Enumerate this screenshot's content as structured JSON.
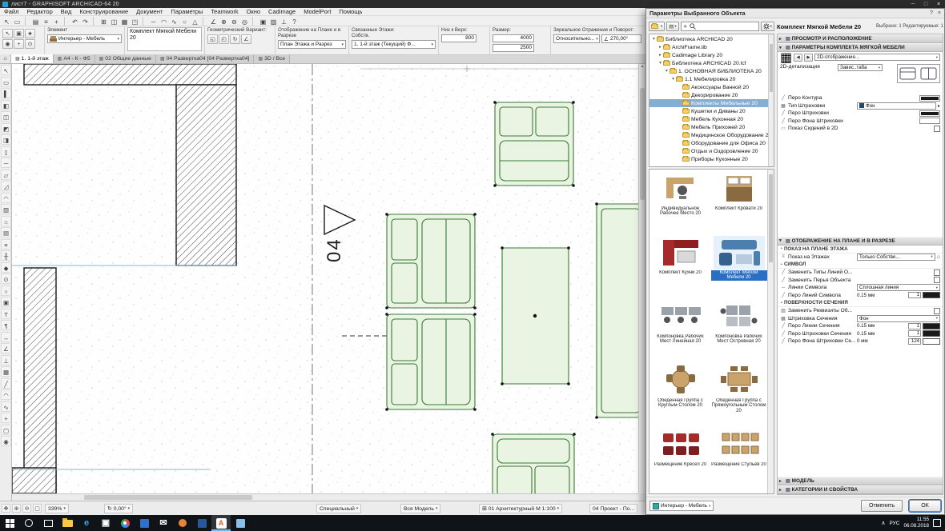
{
  "titlebar": {
    "title": "лист7 - GRAPHISOFT ARCHICAD-64 20",
    "controls": {
      "minimize": "─",
      "maximize": "□",
      "close": "×"
    }
  },
  "menubar": [
    "Файл",
    "Редактор",
    "Вид",
    "Конструирование",
    "Документ",
    "Параметры",
    "Teamwork",
    "Окно",
    "Cadimage",
    "ModelPort",
    "Помощь"
  ],
  "toolbar": [
    {
      "name": "select-tool-icon",
      "glyph": "↖"
    },
    {
      "name": "marquee-tool-icon",
      "glyph": "▭"
    },
    {
      "sep": true
    },
    {
      "name": "open-icon",
      "glyph": "▤"
    },
    {
      "name": "menu-icon",
      "glyph": "≡"
    },
    {
      "name": "add-icon",
      "glyph": "+"
    },
    {
      "sep": true
    },
    {
      "name": "undo-icon",
      "glyph": "↶"
    },
    {
      "name": "redo-icon",
      "glyph": "↷"
    },
    {
      "sep": true
    },
    {
      "name": "grid-icon",
      "glyph": "⊞"
    },
    {
      "name": "split-window-icon",
      "glyph": "◫"
    },
    {
      "name": "fill-display-icon",
      "glyph": "▦"
    },
    {
      "name": "view-icon",
      "glyph": "◳"
    },
    {
      "sep": true
    },
    {
      "name": "line-tool-icon",
      "glyph": "─"
    },
    {
      "name": "arc-tool-icon",
      "glyph": "◠"
    },
    {
      "name": "spline-tool-icon",
      "glyph": "∿"
    },
    {
      "name": "circle-tool-icon",
      "glyph": "○"
    },
    {
      "name": "polygon-tool-icon",
      "glyph": "△"
    },
    {
      "sep": true
    },
    {
      "name": "angle-icon",
      "glyph": "∠"
    },
    {
      "name": "zoom-in-icon",
      "glyph": "⊕"
    },
    {
      "name": "zoom-out-icon",
      "glyph": "⊖"
    },
    {
      "name": "find-icon",
      "glyph": "◎"
    },
    {
      "sep": true
    },
    {
      "name": "layout-icon",
      "glyph": "▣"
    },
    {
      "name": "hatch-icon",
      "glyph": "▨"
    },
    {
      "name": "level-icon",
      "glyph": "⊥"
    },
    {
      "name": "help-icon",
      "glyph": "?"
    }
  ],
  "infobox": {
    "quick_icons": [
      {
        "name": "arrow-settings-icon",
        "glyph": "↖"
      },
      {
        "name": "default-settings-icon",
        "glyph": "▣"
      },
      {
        "name": "favorites-icon",
        "glyph": "★"
      },
      {
        "name": "eyedropper-icon",
        "glyph": "◉"
      },
      {
        "name": "pointer-icon",
        "glyph": "+"
      },
      {
        "name": "pin-icon",
        "glyph": "⊙"
      }
    ],
    "element_label": "Элемент",
    "layer_value": "Интерьер - Мебель",
    "object_name": "Комплект Мягкой Мебели 20",
    "geometry_label": "Геометрический Вариант:",
    "geometry_icons": [
      {
        "name": "rotate-variant-1-icon",
        "glyph": "◱"
      },
      {
        "name": "rotate-variant-2-icon",
        "glyph": "◰"
      },
      {
        "name": "rotate-icon",
        "glyph": "↻"
      },
      {
        "name": "angle-variant-icon",
        "glyph": "∠"
      }
    ],
    "plan_label": "Отображение на Плане и в Разрезе",
    "plan_value": "План Этажа и Разрез",
    "stories_label": "Связанные Этажи:",
    "stories_own": "Собств.",
    "stories_value": "1. 1-й этаж (Текущий) Ф...",
    "bottom_label": "Низ к Верх:",
    "bottom_value": "800",
    "size_label": "Размер:",
    "size_w": "4000",
    "size_h": "2500",
    "mirror_label": "Зеркальное Отражение и Поворот:",
    "mirror_rel": "Относительно...",
    "angle_value": "270,00°"
  },
  "tabbar": {
    "home_glyph": "⌂",
    "tabs": [
      {
        "label": "1. 1-й этаж",
        "active": true
      },
      {
        "label": "А4 - К - Ф5",
        "active": false
      },
      {
        "label": "02 Общие данные",
        "active": false
      },
      {
        "label": "04 Развертка04 [04 Развертка04]",
        "active": false
      },
      {
        "label": "3D / Все",
        "active": false
      }
    ]
  },
  "palette": [
    {
      "name": "arrow-tool-icon",
      "glyph": "↖"
    },
    {
      "name": "marquee-tool-icon",
      "glyph": "▭"
    },
    {
      "name": "wall-tool-icon",
      "glyph": "▌"
    },
    {
      "name": "door-tool-icon",
      "glyph": "◧"
    },
    {
      "name": "window-tool-icon",
      "glyph": "◫"
    },
    {
      "name": "corner-window-tool-icon",
      "glyph": "◩"
    },
    {
      "name": "skylight-tool-icon",
      "glyph": "◨"
    },
    {
      "name": "column-tool-icon",
      "glyph": "▯"
    },
    {
      "name": "beam-tool-icon",
      "glyph": "─"
    },
    {
      "name": "slab-tool-icon",
      "glyph": "▱"
    },
    {
      "name": "roof-tool-icon",
      "glyph": "◿"
    },
    {
      "name": "shell-tool-icon",
      "glyph": "◠"
    },
    {
      "name": "mesh-tool-icon",
      "glyph": "▨"
    },
    {
      "name": "zone-tool-icon",
      "glyph": "⌂"
    },
    {
      "name": "curtain-wall-tool-icon",
      "glyph": "▤"
    },
    {
      "name": "stair-tool-icon",
      "glyph": "≡"
    },
    {
      "name": "railing-tool-icon",
      "glyph": "╫"
    },
    {
      "name": "morph-tool-icon",
      "glyph": "◆"
    },
    {
      "name": "object-tool-icon",
      "glyph": "⊙"
    },
    {
      "name": "lamp-tool-icon",
      "glyph": "○"
    },
    {
      "name": "equipment-tool-icon",
      "glyph": "▣"
    },
    {
      "name": "text-tool-icon",
      "glyph": "Т"
    },
    {
      "name": "label-tool-icon",
      "glyph": "¶"
    },
    {
      "name": "dimension-tool-icon",
      "glyph": "↔"
    },
    {
      "name": "radial-dimension-tool-icon",
      "glyph": "∠"
    },
    {
      "name": "level-dimension-tool-icon",
      "glyph": "⊥"
    },
    {
      "name": "fill-tool-icon",
      "glyph": "▦"
    },
    {
      "name": "line-tool-icon",
      "glyph": "╱"
    },
    {
      "name": "arc-tool-icon",
      "glyph": "◠"
    },
    {
      "name": "spline-tool-icon",
      "glyph": "∿"
    },
    {
      "name": "hotspot-tool-icon",
      "glyph": "+"
    },
    {
      "name": "figure-tool-icon",
      "glyph": "▢"
    },
    {
      "name": "camera-tool-icon",
      "glyph": "◉"
    }
  ],
  "canvas": {
    "marker_label": "04"
  },
  "statusbar": {
    "icons": [
      {
        "name": "pan-icon",
        "glyph": "✥"
      },
      {
        "name": "zoom-in-icon",
        "glyph": "⊕"
      },
      {
        "name": "zoom-out-icon",
        "glyph": "⊖"
      },
      {
        "name": "fit-view-icon",
        "glyph": "▢"
      }
    ],
    "zoom": "339%",
    "angle": "0,00°",
    "mode": "Специальный",
    "model": "Вся Модель",
    "scale": "01 Архитектурный М 1:100",
    "layout": "04 Проект - По..."
  },
  "dialog": {
    "title": "Параметры Выбранного Объекта",
    "controls": {
      "help": "?",
      "close": "×"
    },
    "header_title": "Комплект Мягкой Мебели 20",
    "header_selected": "Выбрано: 1 Редактируемые: 1",
    "layer_value": "Интерьер - Мебель",
    "buttons": {
      "cancel": "Отменить",
      "ok": "ОК"
    },
    "library_tree": [
      {
        "label": "Библиотека ARCHICAD 20",
        "depth": 0,
        "exp": "open"
      },
      {
        "label": "ArchiFrame.lib",
        "depth": 1,
        "exp": "closed"
      },
      {
        "label": "Cadimage Library 20",
        "depth": 1,
        "exp": "closed"
      },
      {
        "label": "Библиотека ARCHICAD 20.lcf",
        "depth": 1,
        "exp": "open"
      },
      {
        "label": "1. ОСНОВНАЯ БИБЛИОТЕКА 20",
        "depth": 2,
        "exp": "open"
      },
      {
        "label": "1.1 Мебелировка 20",
        "depth": 3,
        "exp": "open"
      },
      {
        "label": "Аксессуары Ванной 20",
        "depth": 4
      },
      {
        "label": "Декорирование 20",
        "depth": 4
      },
      {
        "label": "Комплекты Мебельные 20",
        "depth": 4,
        "selected": true
      },
      {
        "label": "Кушетки и Диваны 20",
        "depth": 4
      },
      {
        "label": "Мебель Кухонная 20",
        "depth": 4
      },
      {
        "label": "Мебель Прихожей 20",
        "depth": 4
      },
      {
        "label": "Медицинское Оборудование 20",
        "depth": 4
      },
      {
        "label": "Оборудование для Офиса 20",
        "depth": 4
      },
      {
        "label": "Отдых и Оздоровление 20",
        "depth": 4
      },
      {
        "label": "Приборы Кухонные 20",
        "depth": 4
      }
    ],
    "thumbnails": [
      {
        "label": "Индивидуальное Рабочее Место 20",
        "kind": "desk"
      },
      {
        "label": "Комплект Кровати 20",
        "kind": "bed"
      },
      {
        "label": "Комплект Кухни 20",
        "kind": "kitchen"
      },
      {
        "label": "Комплект Мягкой Мебели 20",
        "kind": "sofa",
        "selected": true
      },
      {
        "label": "Компоновка Рабочих Мест Линейная 20",
        "kind": "desks-linear"
      },
      {
        "label": "Компоновка Рабочих Мест Островная 20",
        "kind": "desks-island"
      },
      {
        "label": "Обеденная Группа с Круглым Столом 20",
        "kind": "dining-round"
      },
      {
        "label": "Обеденная Группа с Прямоугольным Столом 20",
        "kind": "dining-rect"
      },
      {
        "label": "Размещение Кресел 20",
        "kind": "armchairs"
      },
      {
        "label": "Размещение Стульев 20",
        "kind": "chairs"
      }
    ],
    "param_rows": [
      {
        "t": "section",
        "open": false,
        "label": "ПРОСМОТР И РАСПОЛОЖЕНИЕ"
      },
      {
        "t": "section",
        "open": true,
        "label": "ПАРАМЕТРЫ КОМПЛЕКТА МЯГКОЙ МЕБЕЛИ"
      },
      {
        "t": "nav",
        "value": "2D-отображение..."
      },
      {
        "t": "detail",
        "label": "2D-детализация",
        "value": "Завис..таба"
      },
      {
        "t": "gap",
        "h": 14
      },
      {
        "t": "row",
        "icon": "pen",
        "label": "Перо Контура",
        "controls": [
          {
            "c": "pen",
            "v": "#1a1a1a"
          }
        ]
      },
      {
        "t": "row",
        "icon": "fill",
        "label": "Тип Штриховки",
        "controls": [
          {
            "c": "filldrop",
            "v": "Фон"
          },
          {
            "c": "arrow",
            "v": "▸"
          }
        ]
      },
      {
        "t": "row",
        "icon": "pen",
        "label": "Перо Штриховки",
        "controls": [
          {
            "c": "pen",
            "v": "#1a1a1a"
          }
        ]
      },
      {
        "t": "row",
        "icon": "pen",
        "label": "Перо Фона Штриховки",
        "controls": [
          {
            "c": "pen",
            "v": "#ffffff"
          }
        ]
      },
      {
        "t": "row",
        "icon": "seat",
        "label": "Показ Сидений в 2D",
        "controls": [
          {
            "c": "check"
          }
        ]
      },
      {
        "t": "gap",
        "h": 130
      },
      {
        "t": "section",
        "open": true,
        "label": "ОТОБРАЖЕНИЕ НА ПЛАНЕ И В РАЗРЕЗЕ"
      },
      {
        "t": "sub",
        "label": "ПОКАЗ НА ПЛАНЕ ЭТАЖА"
      },
      {
        "t": "row",
        "icon": "floors",
        "label": "Показ на Этажах",
        "controls": [
          {
            "c": "drop",
            "v": "Только Собстве..."
          },
          {
            "c": "mini",
            "v": "⌂"
          }
        ]
      },
      {
        "t": "sub",
        "label": "СИМВОЛ"
      },
      {
        "t": "row",
        "icon": "pen",
        "label": "Заменить Типы Линий О...",
        "controls": [
          {
            "c": "check"
          }
        ]
      },
      {
        "t": "row",
        "icon": "pen",
        "label": "Заменить Перья Объекта",
        "controls": [
          {
            "c": "check"
          }
        ]
      },
      {
        "t": "row",
        "icon": "line",
        "label": "Линии Символа",
        "controls": [
          {
            "c": "drop",
            "v": "Сплошная линия"
          }
        ]
      },
      {
        "t": "row",
        "icon": "pen",
        "label": "Перо Линий Символа",
        "controls": [
          {
            "c": "text",
            "v": "0.15 мм"
          },
          {
            "c": "num",
            "v": "1"
          },
          {
            "c": "swatch",
            "v": "#1a1a1a"
          }
        ]
      },
      {
        "t": "sub",
        "label": "ПОВЕРХНОСТИ СЕЧЕНИЯ"
      },
      {
        "t": "row",
        "icon": "attr",
        "label": "Заменить Реквизиты Об...",
        "controls": [
          {
            "c": "check"
          }
        ]
      },
      {
        "t": "row",
        "icon": "fill",
        "label": "Штриховка Сечения",
        "controls": [
          {
            "c": "drop",
            "v": "Фон"
          }
        ]
      },
      {
        "t": "row",
        "icon": "pen",
        "label": "Перо Линии Сечения",
        "controls": [
          {
            "c": "text",
            "v": "0.15 мм"
          },
          {
            "c": "num",
            "v": "1"
          },
          {
            "c": "swatch",
            "v": "#1a1a1a"
          }
        ]
      },
      {
        "t": "row",
        "icon": "pen",
        "label": "Перо Штриховки Сечения",
        "controls": [
          {
            "c": "text",
            "v": "0.15 мм"
          },
          {
            "c": "num",
            "v": "1"
          },
          {
            "c": "swatch",
            "v": "#1a1a1a"
          }
        ]
      },
      {
        "t": "row",
        "icon": "pen",
        "label": "Перо Фона Штриховки Се...",
        "controls": [
          {
            "c": "text",
            "v": "0 мм"
          },
          {
            "c": "num",
            "v": "124"
          },
          {
            "c": "swatch",
            "v": "#ffffff"
          }
        ]
      },
      {
        "t": "section",
        "open": false,
        "label": "МОДЕЛЬ",
        "push": true
      },
      {
        "t": "section",
        "open": false,
        "label": "КАТЕГОРИИ И СВОЙСТВА"
      }
    ]
  },
  "taskbar": {
    "icons": [
      {
        "name": "start-button",
        "kind": "start",
        "active": false
      },
      {
        "name": "search-button",
        "kind": "circle",
        "color": "#ffffff",
        "active": false
      },
      {
        "name": "task-view-button",
        "kind": "frame",
        "active": false
      },
      {
        "name": "file-explorer-button",
        "kind": "folder",
        "active": false
      },
      {
        "name": "edge-browser-button",
        "kind": "letter",
        "glyph": "e",
        "color": "#35a3e8",
        "active": false
      },
      {
        "name": "store-button",
        "kind": "letter",
        "glyph": "▣",
        "color": "#ffffff",
        "active": false
      },
      {
        "name": "chrome-browser-button",
        "kind": "circle3",
        "active": false
      },
      {
        "name": "photos-app-button",
        "kind": "square",
        "color": "#2f6fd0",
        "active": false
      },
      {
        "name": "mail-app-button",
        "kind": "letter",
        "glyph": "✉",
        "color": "#ffffff",
        "active": false
      },
      {
        "name": "firefox-browser-button",
        "kind": "circle",
        "color": "#e8833a",
        "active": false
      },
      {
        "name": "word-app-button",
        "kind": "square",
        "color": "#2b5797",
        "active": false
      },
      {
        "name": "archicad-button",
        "kind": "archicad",
        "glyph": "A",
        "active": true
      },
      {
        "name": "paint-app-button",
        "kind": "square",
        "color": "#8ac0e8",
        "active": false
      }
    ],
    "tray_lang": "РУС",
    "time": "11:55",
    "date": "06.08.2018"
  }
}
